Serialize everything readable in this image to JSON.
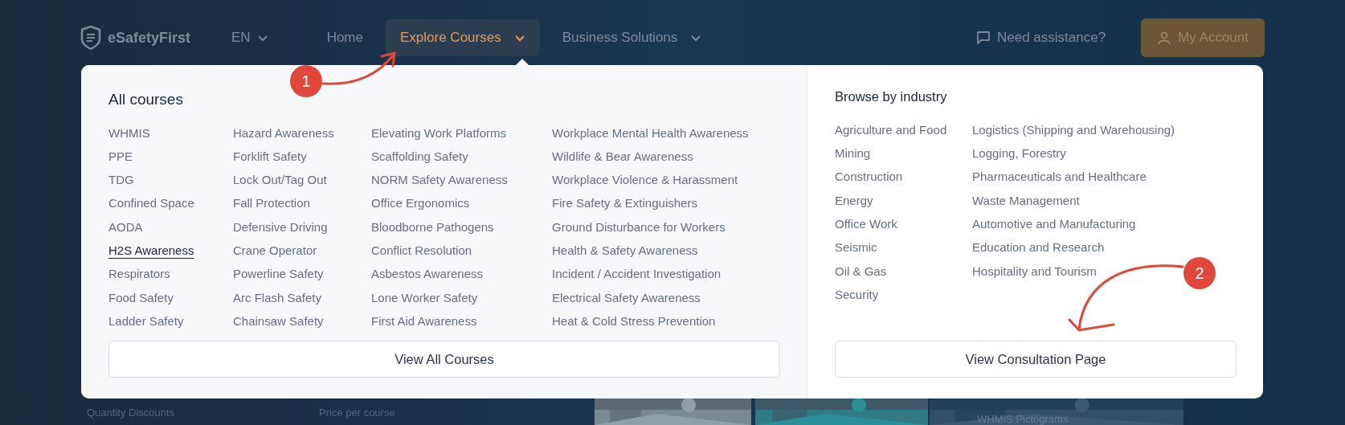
{
  "nav": {
    "brand": "eSafetyFirst",
    "language": "EN",
    "items": [
      {
        "label": "Home",
        "selected": false,
        "dropdown": false
      },
      {
        "label": "Explore Courses",
        "selected": true,
        "dropdown": true
      },
      {
        "label": "Business Solutions",
        "selected": false,
        "dropdown": true
      }
    ],
    "help_link": "Need assistance?",
    "account_button": "My Account"
  },
  "menu": {
    "courses_heading": "All courses",
    "course_columns": [
      [
        {
          "label": "WHMIS",
          "selected": false
        },
        {
          "label": "PPE",
          "selected": false
        },
        {
          "label": "TDG",
          "selected": false
        },
        {
          "label": "Confined Space",
          "selected": false
        },
        {
          "label": "AODA",
          "selected": false
        },
        {
          "label": "H2S Awareness",
          "selected": true
        },
        {
          "label": "Respirators",
          "selected": false
        },
        {
          "label": "Food Safety",
          "selected": false
        },
        {
          "label": "Ladder Safety",
          "selected": false
        }
      ],
      [
        {
          "label": "Hazard Awareness",
          "selected": false
        },
        {
          "label": "Forklift Safety",
          "selected": false
        },
        {
          "label": "Lock Out/Tag Out",
          "selected": false
        },
        {
          "label": "Fall Protection",
          "selected": false
        },
        {
          "label": "Defensive Driving",
          "selected": false
        },
        {
          "label": "Crane Operator",
          "selected": false
        },
        {
          "label": "Powerline Safety",
          "selected": false
        },
        {
          "label": "Arc Flash Safety",
          "selected": false
        },
        {
          "label": "Chainsaw Safety",
          "selected": false
        }
      ],
      [
        {
          "label": "Elevating Work Platforms",
          "selected": false
        },
        {
          "label": "Scaffolding Safety",
          "selected": false
        },
        {
          "label": "NORM Safety Awareness",
          "selected": false
        },
        {
          "label": "Office Ergonomics",
          "selected": false
        },
        {
          "label": "Bloodborne Pathogens",
          "selected": false
        },
        {
          "label": "Conflict Resolution",
          "selected": false
        },
        {
          "label": "Asbestos Awareness",
          "selected": false
        },
        {
          "label": "Lone Worker Safety",
          "selected": false
        },
        {
          "label": "First Aid Awareness",
          "selected": false
        }
      ],
      [
        {
          "label": "Workplace Mental Health Awareness",
          "selected": false
        },
        {
          "label": "Wildlife & Bear Awareness",
          "selected": false
        },
        {
          "label": "Workplace Violence & Harassment",
          "selected": false
        },
        {
          "label": "Fire Safety & Extinguishers",
          "selected": false
        },
        {
          "label": "Ground Disturbance for Workers",
          "selected": false
        },
        {
          "label": "Health & Safety Awareness",
          "selected": false
        },
        {
          "label": "Incident / Accident Investigation",
          "selected": false
        },
        {
          "label": "Electrical Safety Awareness",
          "selected": false
        },
        {
          "label": "Heat & Cold Stress Prevention",
          "selected": false
        }
      ]
    ],
    "courses_button": "View All Courses",
    "industry_heading": "Browse by industry",
    "industry_columns": [
      [
        "Agriculture and Food",
        "Mining",
        "Construction",
        "Energy",
        "Office Work",
        "Seismic",
        "Oil & Gas",
        "Security"
      ],
      [
        "Logistics (Shipping and Warehousing)",
        "Logging, Forestry",
        "Pharmaceuticals and Healthcare",
        "Waste Management",
        "Automotive and Manufacturing",
        "Education and Research",
        "Hospitality and Tourism"
      ]
    ],
    "industry_button": "View Consultation Page"
  },
  "background": {
    "texts": [
      "Quantity Discounts",
      "Price per course"
    ],
    "tiles": [
      {
        "kind": "picture"
      },
      {
        "kind": "picture"
      },
      {
        "kind": "picture",
        "caption": "WHMIS Pictograms"
      }
    ]
  },
  "annotations": [
    {
      "number": "1"
    },
    {
      "number": "2"
    }
  ]
}
